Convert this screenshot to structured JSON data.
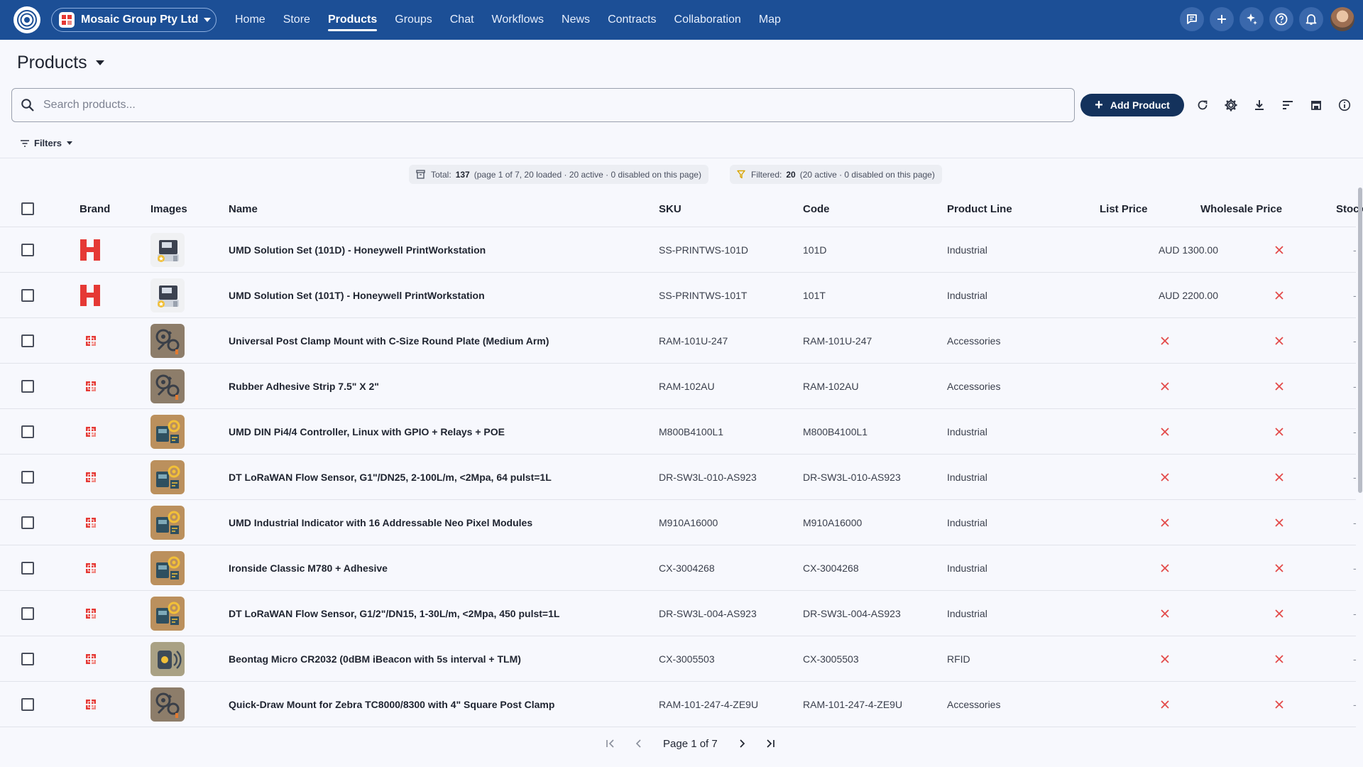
{
  "topbar": {
    "org_name": "Mosaic Group Pty Ltd",
    "nav": [
      "Home",
      "Store",
      "Products",
      "Groups",
      "Chat",
      "Workflows",
      "News",
      "Contracts",
      "Collaboration",
      "Map"
    ],
    "active_nav": "Products",
    "icons": [
      "chat-icon",
      "plus-icon",
      "sparkle-icon",
      "help-icon",
      "bell-icon"
    ]
  },
  "page": {
    "title": "Products",
    "search_placeholder": "Search products...",
    "add_button": "Add Product",
    "filters_label": "Filters"
  },
  "summary": {
    "total_label": "Total:",
    "total_value": "137",
    "total_detail": "(page 1 of 7, 20 loaded · 20 active · 0 disabled on this page)",
    "filtered_label": "Filtered:",
    "filtered_value": "20",
    "filtered_detail": "(20 active · 0 disabled on this page)"
  },
  "table": {
    "columns": [
      "Brand",
      "Images",
      "Name",
      "SKU",
      "Code",
      "Product Line",
      "List Price",
      "Wholesale Price",
      "Stock"
    ],
    "rows": [
      {
        "brand": "honeywell",
        "image": "printer",
        "name": "UMD Solution Set (101D) - Honeywell PrintWorkstation",
        "sku": "SS-PRINTWS-101D",
        "code": "101D",
        "line": "Industrial",
        "list_price": "AUD 1300.00"
      },
      {
        "brand": "honeywell",
        "image": "printer",
        "name": "UMD Solution Set (101T) - Honeywell PrintWorkstation",
        "sku": "SS-PRINTWS-101T",
        "code": "101T",
        "line": "Industrial",
        "list_price": "AUD 2200.00"
      },
      {
        "brand": "mosaic",
        "image": "gear",
        "name": "Universal Post Clamp Mount with C-Size Round Plate (Medium Arm)",
        "sku": "RAM-101U-247",
        "code": "RAM-101U-247",
        "line": "Accessories",
        "list_price": ""
      },
      {
        "brand": "mosaic",
        "image": "gear",
        "name": "Rubber Adhesive Strip 7.5\" X 2\"",
        "sku": "RAM-102AU",
        "code": "RAM-102AU",
        "line": "Accessories",
        "list_price": ""
      },
      {
        "brand": "mosaic",
        "image": "device",
        "name": "UMD DIN Pi4/4 Controller, Linux with GPIO + Relays + POE",
        "sku": "M800B4100L1",
        "code": "M800B4100L1",
        "line": "Industrial",
        "list_price": ""
      },
      {
        "brand": "mosaic",
        "image": "device",
        "name": "DT LoRaWAN Flow Sensor, G1\"/DN25, 2-100L/m, <2Mpa, 64 pulst=1L",
        "sku": "DR-SW3L-010-AS923",
        "code": "DR-SW3L-010-AS923",
        "line": "Industrial",
        "list_price": ""
      },
      {
        "brand": "mosaic",
        "image": "device",
        "name": "UMD Industrial Indicator with 16 Addressable Neo Pixel Modules",
        "sku": "M910A16000",
        "code": "M910A16000",
        "line": "Industrial",
        "list_price": ""
      },
      {
        "brand": "mosaic",
        "image": "device",
        "name": "Ironside Classic M780 + Adhesive",
        "sku": "CX-3004268",
        "code": "CX-3004268",
        "line": "Industrial",
        "list_price": ""
      },
      {
        "brand": "mosaic",
        "image": "device",
        "name": "DT LoRaWAN Flow Sensor, G1/2\"/DN15, 1-30L/m, <2Mpa, 450 pulst=1L",
        "sku": "DR-SW3L-004-AS923",
        "code": "DR-SW3L-004-AS923",
        "line": "Industrial",
        "list_price": ""
      },
      {
        "brand": "mosaic",
        "image": "beacon",
        "name": "Beontag Micro CR2032 (0dBM iBeacon with 5s interval + TLM)",
        "sku": "CX-3005503",
        "code": "CX-3005503",
        "line": "RFID",
        "list_price": ""
      },
      {
        "brand": "mosaic",
        "image": "gear",
        "name": "Quick-Draw Mount for Zebra TC8000/8300 with 4\" Square Post Clamp",
        "sku": "RAM-101-247-4-ZE9U",
        "code": "RAM-101-247-4-ZE9U",
        "line": "Accessories",
        "list_price": ""
      }
    ]
  },
  "pager": {
    "label": "Page 1 of 7"
  },
  "colors": {
    "topbar": "#1c4f96",
    "primary_button": "#14325c",
    "brand_red": "#e53935",
    "missing_mark": "#e34a4a"
  }
}
